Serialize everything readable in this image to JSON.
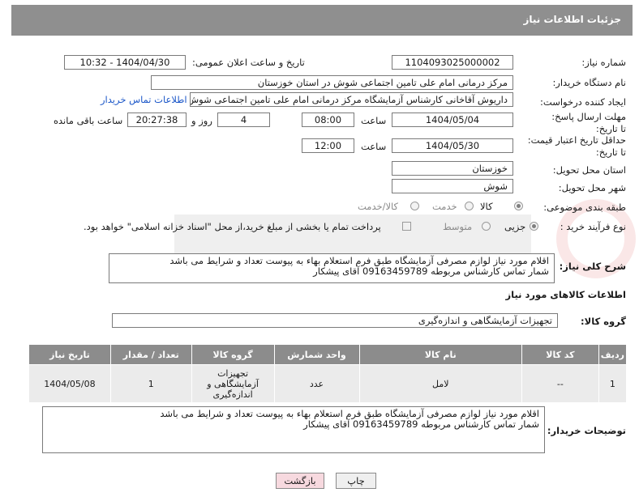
{
  "header": {
    "title": "جزئیات اطلاعات نیاز"
  },
  "fields": {
    "need_number_label": "شماره نیاز:",
    "need_number": "1104093025000002",
    "announce_label": "تاریخ و ساعت اعلان عمومی:",
    "announce_value": "1404/04/30 - 10:32",
    "buyer_org_label": "نام دستگاه خریدار:",
    "buyer_org": "مرکز درمانی امام علی تامین اجتماعی شوش در استان خوزستان",
    "requester_label": "ایجاد کننده درخواست:",
    "requester": "داریوش آقاخانی کارشناس آزمایشگاه مرکز درمانی امام علی تامین اجتماعی شوش",
    "contact_link": "اطلاعات تماس خریدار",
    "reply_deadline_label": "مهلت ارسال پاسخ: تا تاریخ:",
    "reply_date": "1404/05/04",
    "time_label": "ساعت",
    "reply_time": "08:00",
    "days_value": "4",
    "days_label": "روز و",
    "remaining_time": "20:27:38",
    "remaining_label": "ساعت باقی مانده",
    "price_deadline_label": "حداقل تاریخ اعتبار قیمت: تا تاریخ:",
    "price_date": "1404/05/30",
    "price_time": "12:00",
    "province_label": "استان محل تحویل:",
    "province": "خوزستان",
    "city_label": "شهر محل تحویل:",
    "city": "شوش",
    "category_label": "طبقه بندی موضوعی:",
    "category_options": [
      "کالا",
      "خدمت",
      "کالا/خدمت"
    ],
    "process_label": "نوع فرآیند خرید :",
    "process_options": [
      "جزیی",
      "متوسط"
    ],
    "payment_note": "پرداخت تمام یا بخشی از مبلغ خرید،از محل \"اسناد خزانه اسلامی\" خواهد بود.",
    "description_label": "شرح کلی نیاز:",
    "description": "اقلام مورد نیاز لوازم مصرفی آزمایشگاه طبق فرم استعلام بهاء به پیوست تعداد و شرایط می باشد\nشمار تماس کارشناس مربوطه 09163459789 آقای پیشکار",
    "goods_info_title": "اطلاعات کالاهای مورد نیاز",
    "goods_group_label": "گروه کالا:",
    "goods_group": "تجهیزات آزمایشگاهی و اندازه‌گیری"
  },
  "table": {
    "headers": [
      "ردیف",
      "کد کالا",
      "نام کالا",
      "واحد شمارش",
      "گروه کالا",
      "تعداد / مقدار",
      "تاریخ نیاز"
    ],
    "rows": [
      [
        "1",
        "--",
        "لامل",
        "عدد",
        "تجهیزات آزمایشگاهی و اندازه‌گیری",
        "1",
        "1404/05/08"
      ]
    ]
  },
  "buyer_notes_label": "توضیحات خریدار:",
  "buyer_notes": "اقلام مورد نیاز لوازم مصرفی آزمایشگاه طبق فرم استعلام بهاء به پیوست تعداد و شرایط می باشد\nشمار تماس کارشناس مربوطه 09163459789 آقای پیشکار",
  "buttons": {
    "print": "چاپ",
    "back": "بازگشت"
  },
  "colors": {
    "header_bg": "#8f8f8f",
    "link": "#1a56c8",
    "back_button": "#f7d9df"
  }
}
